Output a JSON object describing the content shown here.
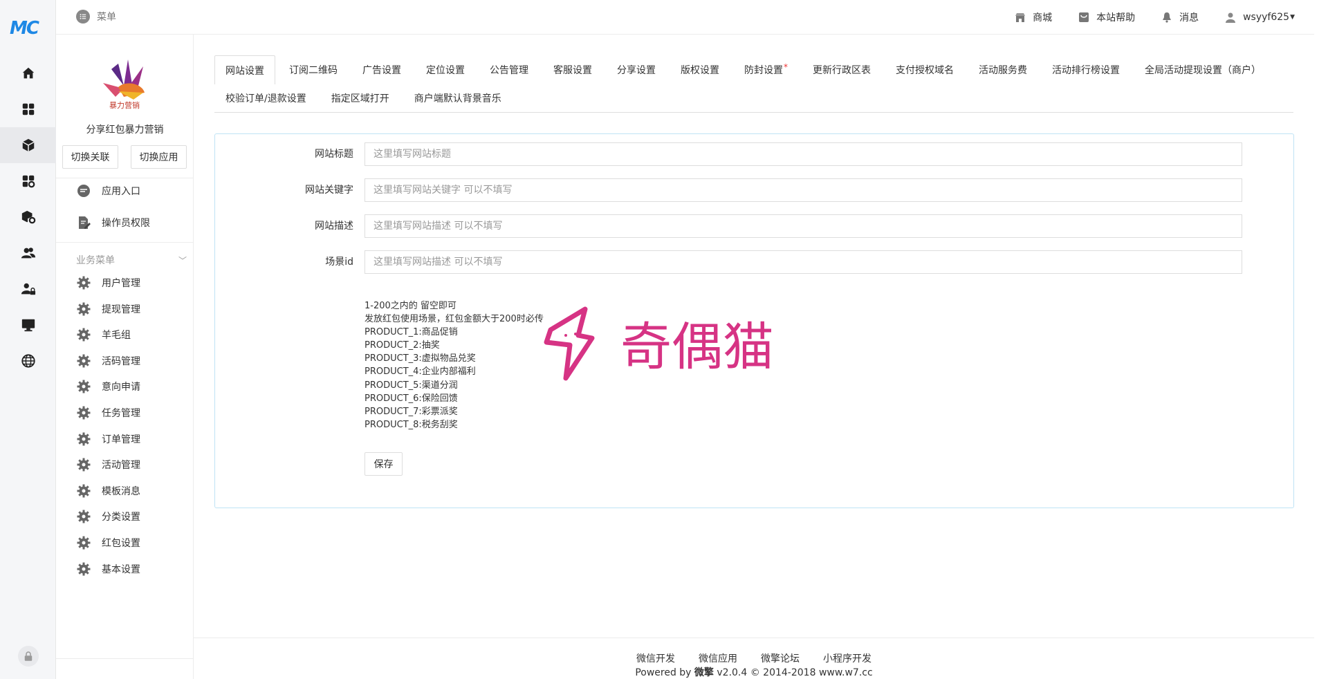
{
  "brand": {
    "logo_text": "MC"
  },
  "rail": {
    "items": [
      {
        "icon": "home-icon"
      },
      {
        "icon": "grid-icon"
      },
      {
        "icon": "cube-icon",
        "active": true
      },
      {
        "icon": "apps-gear-icon"
      },
      {
        "icon": "cube-gear-icon"
      },
      {
        "icon": "users-icon"
      },
      {
        "icon": "user-lock-icon"
      },
      {
        "icon": "monitor-icon"
      },
      {
        "icon": "globe-icon"
      }
    ]
  },
  "header": {
    "menu_label": "菜单",
    "links": [
      {
        "icon": "store-icon",
        "label": "商城"
      },
      {
        "icon": "help-icon",
        "label": "本站帮助"
      },
      {
        "icon": "bell-icon",
        "label": "消息"
      },
      {
        "icon": "user-icon",
        "label": "wsyyf625"
      }
    ]
  },
  "app": {
    "logo_caption": "暴力营销",
    "name": "分享红包暴力营销",
    "switch_link_label": "切换关联",
    "switch_app_label": "切换应用",
    "top_items": [
      {
        "icon": "chat-icon",
        "label": "应用入口"
      },
      {
        "icon": "edit-doc-icon",
        "label": "操作员权限"
      }
    ],
    "section_title": "业务菜单",
    "business_items": [
      {
        "label": "用户管理"
      },
      {
        "label": "提现管理"
      },
      {
        "label": "羊毛组"
      },
      {
        "label": "活码管理"
      },
      {
        "label": "意向申请"
      },
      {
        "label": "任务管理"
      },
      {
        "label": "订单管理"
      },
      {
        "label": "活动管理"
      },
      {
        "label": "模板消息"
      },
      {
        "label": "分类设置"
      },
      {
        "label": "红包设置"
      },
      {
        "label": "基本设置"
      }
    ]
  },
  "tabs": {
    "row1": [
      {
        "label": "网站设置",
        "active": true
      },
      {
        "label": "订阅二维码"
      },
      {
        "label": "广告设置"
      },
      {
        "label": "定位设置"
      },
      {
        "label": "公告管理"
      },
      {
        "label": "客服设置"
      },
      {
        "label": "分享设置"
      },
      {
        "label": "版权设置"
      },
      {
        "label": "防封设置",
        "star": "*"
      },
      {
        "label": "更新行政区表"
      },
      {
        "label": "支付授权域名"
      },
      {
        "label": "活动服务费"
      },
      {
        "label": "活动排行榜设置"
      },
      {
        "label": "全局活动提现设置（商户）"
      }
    ],
    "row2": [
      {
        "label": "校验订单/退款设置"
      },
      {
        "label": "指定区域打开"
      },
      {
        "label": "商户端默认背景音乐"
      }
    ]
  },
  "form": {
    "fields": [
      {
        "label": "网站标题",
        "value": "",
        "placeholder": "这里填写网站标题"
      },
      {
        "label": "网站关键字",
        "value": "",
        "placeholder": "这里填写网站关键字 可以不填写"
      },
      {
        "label": "网站描述",
        "value": "",
        "placeholder": "这里填写网站描述 可以不填写"
      },
      {
        "label": "场景id",
        "value": "",
        "placeholder": "这里填写网站描述 可以不填写"
      }
    ],
    "help_lines": [
      "1-200之内的 留空即可",
      "发放红包使用场景，红包金额大于200时必传",
      "PRODUCT_1:商品促销",
      "PRODUCT_2:抽奖",
      "PRODUCT_3:虚拟物品兑奖",
      "PRODUCT_4:企业内部福利",
      "PRODUCT_5:渠道分润",
      "PRODUCT_6:保险回馈",
      "PRODUCT_7:彩票派奖",
      "PRODUCT_8:税务刮奖"
    ],
    "save_label": "保存"
  },
  "watermark": {
    "text": "奇偶猫"
  },
  "footer": {
    "links": [
      "微信开发",
      "微信应用",
      "微擎论坛",
      "小程序开发"
    ],
    "copy_prefix": "Powered by ",
    "copy_brand": "微擎",
    "copy_suffix": " v2.0.4 © 2014-2018 www.w7.cc"
  },
  "colors": {
    "accent": "#1e88e5",
    "panel_border": "#bfe3f5",
    "watermark": "#d63384"
  }
}
